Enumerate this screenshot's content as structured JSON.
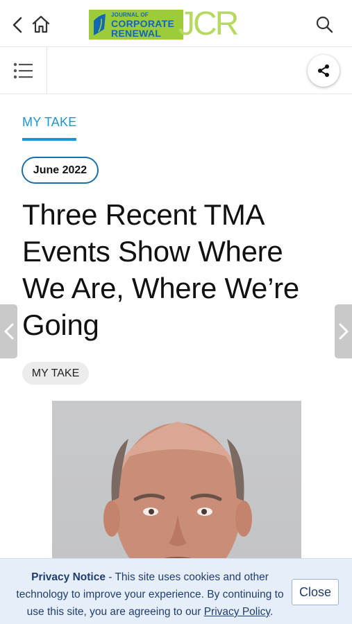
{
  "header": {
    "logo": {
      "line1": "JOURNAL OF",
      "line2": "CORPORATE",
      "line3": "RENEWAL",
      "mark": "JCR"
    },
    "icons": [
      "chevron-left-icon",
      "home-icon",
      "search-icon"
    ]
  },
  "toolbar": {
    "icons": [
      "list-icon",
      "share-icon"
    ]
  },
  "article": {
    "category": "MY TAKE",
    "date": "June 2022",
    "headline": "Three Recent TMA Events Show Where We Are, Where We’re Going",
    "tag": "MY TAKE"
  },
  "privacy": {
    "title": "Privacy Notice",
    "body": " - This site uses cookies and other technology to improve your experience. By continuing to use this site, you are agreeing to our ",
    "link": "Privacy Policy",
    "end": ".",
    "close_label": "Close"
  },
  "colors": {
    "accent": "#1a96d4",
    "logo_green": "#9ccb3b",
    "logo_blue": "#1268b0",
    "privacy_bg": "#e6eff9",
    "privacy_text": "#1f3c6e"
  }
}
